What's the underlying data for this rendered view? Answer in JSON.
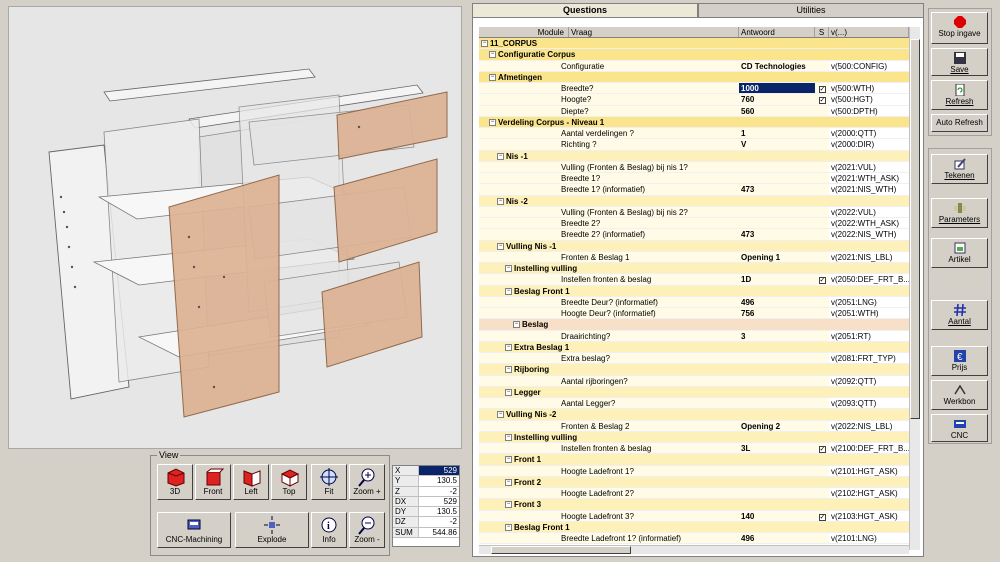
{
  "tabs": [
    "Questions",
    "Utilities"
  ],
  "grid": {
    "columns": [
      "Module",
      "Vraag",
      "Antwoord",
      "S",
      "v(...)"
    ],
    "rows": [
      {
        "level": 0,
        "style": "hdr",
        "label": "11_CORPUS",
        "q": "",
        "a": "",
        "s": "",
        "v": ""
      },
      {
        "level": 1,
        "style": "hdr",
        "label": "Configuratie Corpus",
        "q": "",
        "a": "",
        "s": "",
        "v": ""
      },
      {
        "level": 2,
        "style": "q",
        "label": "",
        "q": "Configuratie",
        "a": "CD Technologies",
        "s": "",
        "v": "v(500:CONFIG)"
      },
      {
        "level": 1,
        "style": "hdr",
        "label": "Afmetingen",
        "q": "",
        "a": "",
        "s": "",
        "v": ""
      },
      {
        "level": 2,
        "style": "q",
        "label": "",
        "q": "Breedte?",
        "a": "1000",
        "s": "check",
        "v": "v(500:WTH)",
        "hl": true
      },
      {
        "level": 2,
        "style": "q",
        "label": "",
        "q": "Hoogte?",
        "a": "760",
        "s": "check",
        "v": "v(500:HGT)"
      },
      {
        "level": 2,
        "style": "q",
        "label": "",
        "q": "Diepte?",
        "a": "560",
        "s": "",
        "v": "v(500:DPTH)"
      },
      {
        "level": 1,
        "style": "hdr",
        "label": "Verdeling Corpus  - Niveau 1",
        "q": "",
        "a": "",
        "s": "",
        "v": ""
      },
      {
        "level": 2,
        "style": "q",
        "label": "",
        "q": "Aantal verdelingen ?",
        "a": "1",
        "s": "",
        "v": "v(2000:QTT)"
      },
      {
        "level": 2,
        "style": "q",
        "label": "",
        "q": "Richting ?",
        "a": "V",
        "s": "",
        "v": "v(2000:DIR)"
      },
      {
        "level": 2,
        "style": "hdr2",
        "label": "Nis -1",
        "q": "",
        "a": "",
        "s": "",
        "v": ""
      },
      {
        "level": 3,
        "style": "q",
        "label": "",
        "q": "Vulling (Fronten & Beslag) bij nis 1?",
        "a": "",
        "s": "",
        "v": "v(2021:VUL)"
      },
      {
        "level": 3,
        "style": "q",
        "label": "",
        "q": "Breedte 1?",
        "a": "",
        "s": "",
        "v": "v(2021:WTH_ASK)"
      },
      {
        "level": 3,
        "style": "q",
        "label": "",
        "q": "Breedte 1? (informatief)",
        "a": "473",
        "s": "",
        "v": "v(2021:NIS_WTH)"
      },
      {
        "level": 2,
        "style": "hdr2",
        "label": "Nis -2",
        "q": "",
        "a": "",
        "s": "",
        "v": ""
      },
      {
        "level": 3,
        "style": "q",
        "label": "",
        "q": "Vulling (Fronten & Beslag) bij nis 2?",
        "a": "",
        "s": "",
        "v": "v(2022:VUL)"
      },
      {
        "level": 3,
        "style": "q",
        "label": "",
        "q": "Breedte 2?",
        "a": "",
        "s": "",
        "v": "v(2022:WTH_ASK)"
      },
      {
        "level": 3,
        "style": "q",
        "label": "",
        "q": "Breedte 2? (informatief)",
        "a": "473",
        "s": "",
        "v": "v(2022:NIS_WTH)"
      },
      {
        "level": 2,
        "style": "hdr2",
        "label": "Vulling Nis -1",
        "q": "",
        "a": "",
        "s": "",
        "v": ""
      },
      {
        "level": 3,
        "style": "q",
        "label": "",
        "q": "Fronten & Beslag  1",
        "a": "Opening 1",
        "s": "",
        "v": "v(2021:NIS_LBL)"
      },
      {
        "level": 3,
        "style": "hdr2",
        "label": "Instelling vulling",
        "q": "",
        "a": "",
        "s": "",
        "v": ""
      },
      {
        "level": 4,
        "style": "q",
        "label": "",
        "q": "Instellen fronten & beslag",
        "a": "1D",
        "s": "check",
        "v": "v(2050:DEF_FRT_B..."
      },
      {
        "level": 3,
        "style": "hdr2",
        "label": "Beslag Front 1",
        "q": "",
        "a": "",
        "s": "",
        "v": ""
      },
      {
        "level": 4,
        "style": "q",
        "label": "",
        "q": "Breedte Deur? (informatief)",
        "a": "496",
        "s": "",
        "v": "v(2051:LNG)"
      },
      {
        "level": 4,
        "style": "q",
        "label": "",
        "q": "Hoogte Deur? (informatief)",
        "a": "756",
        "s": "",
        "v": "v(2051:WTH)"
      },
      {
        "level": 4,
        "style": "hdr3",
        "label": "Beslag",
        "q": "",
        "a": "",
        "s": "",
        "v": ""
      },
      {
        "level": 5,
        "style": "q",
        "label": "",
        "q": "Draairichting?",
        "a": "3",
        "s": "",
        "v": "v(2051:RT)"
      },
      {
        "level": 3,
        "style": "hdr2",
        "label": "Extra Beslag 1",
        "q": "",
        "a": "",
        "s": "",
        "v": ""
      },
      {
        "level": 4,
        "style": "q",
        "label": "",
        "q": "Extra beslag?",
        "a": "",
        "s": "",
        "v": "v(2081:FRT_TYP)"
      },
      {
        "level": 3,
        "style": "hdr2",
        "label": "Rijboring",
        "q": "",
        "a": "",
        "s": "",
        "v": ""
      },
      {
        "level": 4,
        "style": "q",
        "label": "",
        "q": "Aantal rijboringen?",
        "a": "",
        "s": "",
        "v": "v(2092:QTT)"
      },
      {
        "level": 3,
        "style": "hdr2",
        "label": "Legger",
        "q": "",
        "a": "",
        "s": "",
        "v": ""
      },
      {
        "level": 4,
        "style": "q",
        "label": "",
        "q": "Aantal Legger?",
        "a": "",
        "s": "",
        "v": "v(2093:QTT)"
      },
      {
        "level": 2,
        "style": "hdr2",
        "label": "Vulling Nis -2",
        "q": "",
        "a": "",
        "s": "",
        "v": ""
      },
      {
        "level": 3,
        "style": "q",
        "label": "",
        "q": "Fronten & Beslag  2",
        "a": "Opening 2",
        "s": "",
        "v": "v(2022:NIS_LBL)"
      },
      {
        "level": 3,
        "style": "hdr2",
        "label": "Instelling vulling",
        "q": "",
        "a": "",
        "s": "",
        "v": ""
      },
      {
        "level": 4,
        "style": "q",
        "label": "",
        "q": "Instellen fronten & beslag",
        "a": "3L",
        "s": "check",
        "v": "v(2100:DEF_FRT_B..."
      },
      {
        "level": 3,
        "style": "hdr2",
        "label": "Front 1",
        "q": "",
        "a": "",
        "s": "",
        "v": ""
      },
      {
        "level": 4,
        "style": "q",
        "label": "",
        "q": "Hoogte Ladefront 1?",
        "a": "",
        "s": "",
        "v": "v(2101:HGT_ASK)"
      },
      {
        "level": 3,
        "style": "hdr2",
        "label": "Front 2",
        "q": "",
        "a": "",
        "s": "",
        "v": ""
      },
      {
        "level": 4,
        "style": "q",
        "label": "",
        "q": "Hoogte Ladefront 2?",
        "a": "",
        "s": "",
        "v": "v(2102:HGT_ASK)"
      },
      {
        "level": 3,
        "style": "hdr2",
        "label": "Front 3",
        "q": "",
        "a": "",
        "s": "",
        "v": ""
      },
      {
        "level": 4,
        "style": "q",
        "label": "",
        "q": "Hoogte Ladefront 3?",
        "a": "140",
        "s": "check",
        "v": "v(2103:HGT_ASK)"
      },
      {
        "level": 3,
        "style": "hdr2",
        "label": "Beslag Front 1",
        "q": "",
        "a": "",
        "s": "",
        "v": ""
      },
      {
        "level": 4,
        "style": "q",
        "label": "",
        "q": "Breedte Ladefront 1? (informatief)",
        "a": "496",
        "s": "",
        "v": "v(2101:LNG)"
      }
    ]
  },
  "view": {
    "group_title": "View",
    "buttons": {
      "b3d": "3D",
      "front": "Front",
      "left": "Left",
      "top": "Top",
      "fit": "Fit",
      "zoom_plus": "Zoom +",
      "cnc": "CNC-Machining",
      "explode": "Explode",
      "info": "Info",
      "zoom_minus": "Zoom -"
    }
  },
  "coords": [
    {
      "k": "X",
      "v": "529"
    },
    {
      "k": "Y",
      "v": "130.5"
    },
    {
      "k": "Z",
      "v": "-2"
    },
    {
      "k": "DX",
      "v": "529"
    },
    {
      "k": "DY",
      "v": "130.5"
    },
    {
      "k": "DZ",
      "v": "-2"
    },
    {
      "k": "SUM",
      "v": "544.86"
    }
  ],
  "side": {
    "stop": "Stop ingave",
    "save": "Save",
    "refresh": "Refresh",
    "auto_refresh": "Auto Refresh",
    "tekenen": "Tekenen",
    "parameters": "Parameters",
    "artikel": "Artikel",
    "aantal": "Aantal",
    "prijs": "Prijs",
    "werkbon": "Werkbon",
    "cnc": "CNC"
  },
  "colors": {
    "panel_accent": "#ddb294",
    "row_header": "#fbe58c",
    "selection": "#0a246a"
  }
}
